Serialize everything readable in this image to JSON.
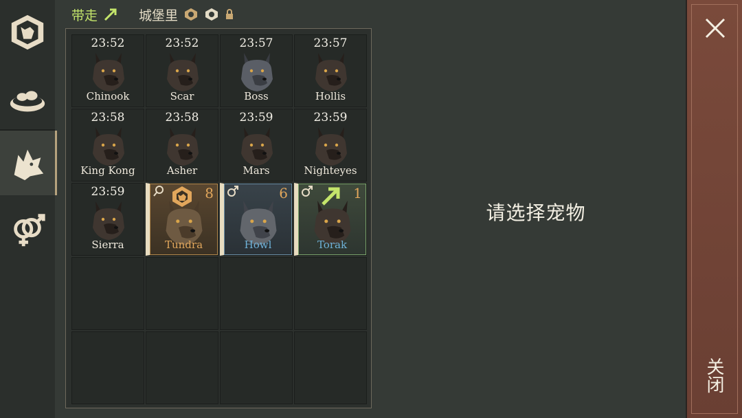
{
  "filters": {
    "take_away": "带走",
    "in_castle": "城堡里"
  },
  "prompt": "请选择宠物",
  "close_label": "关闭",
  "colors": {
    "accent_green": "#c4e56b",
    "level_orange": "#e2a75c",
    "name_blue": "#6fb2d9"
  },
  "rail": [
    {
      "icon": "castle-wolf-icon"
    },
    {
      "icon": "food-bowl-icon"
    },
    {
      "icon": "wolf-head-icon",
      "active": true
    },
    {
      "icon": "breeding-gender-icon"
    }
  ],
  "grid": {
    "cells": [
      {
        "time": "23:52",
        "name": "Chinook"
      },
      {
        "time": "23:52",
        "name": "Scar"
      },
      {
        "time": "23:57",
        "name": "Boss"
      },
      {
        "time": "23:57",
        "name": "Hollis"
      },
      {
        "time": "23:58",
        "name": "King Kong"
      },
      {
        "time": "23:58",
        "name": "Asher"
      },
      {
        "time": "23:59",
        "name": "Mars"
      },
      {
        "time": "23:59",
        "name": "Nighteyes"
      },
      {
        "time": "23:59",
        "name": "Sierra"
      },
      {
        "name": "Tundra",
        "level": "8",
        "sex": "female",
        "tier": "gold",
        "badge": "wolf-badge-icon"
      },
      {
        "name": "Howl",
        "level": "6",
        "sex": "male",
        "tier": "blue"
      },
      {
        "name": "Torak",
        "level": "1",
        "sex": "male",
        "tier": "green",
        "badge": "take-away-icon"
      }
    ],
    "empty_cells": 8
  }
}
